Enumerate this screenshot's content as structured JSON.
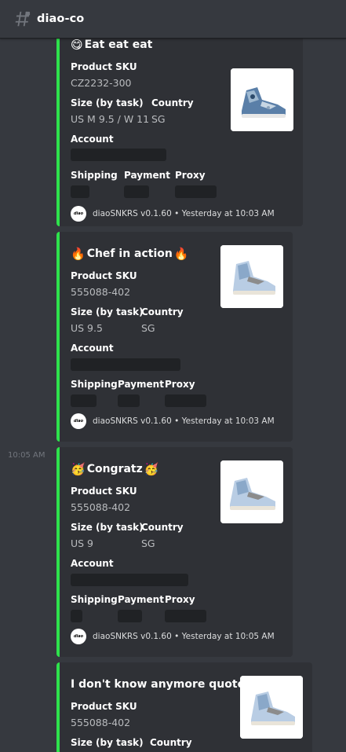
{
  "channel": {
    "name": "diao-co",
    "icon": "hashtag-lock-icon"
  },
  "colors": {
    "background": "#36393f",
    "embed_bg": "#2f3136",
    "embed_border": "#2ee24c",
    "redaction": "#202225"
  },
  "timestamps": {
    "second_group": "10:05 AM"
  },
  "field_labels": {
    "sku": "Product SKU",
    "size": "Size (by task)",
    "country": "Country",
    "account": "Account",
    "shipping": "Shipping",
    "payment": "Payment",
    "proxy": "Proxy"
  },
  "messages": [
    {
      "title": "Eat eat eat",
      "sku": "CZ2232-300",
      "size": "US M 9.5 / W 11",
      "country": "SG",
      "footer_icon_text": "diao",
      "footer": "diaoSNKRS v0.1.60 • Yesterday at 10:03 AM"
    },
    {
      "title": "Chef in action",
      "title_emoji": "🔥",
      "sku": "555088-402",
      "size": "US 9.5",
      "country": "SG",
      "footer_icon_text": "diao",
      "footer": "diaoSNKRS v0.1.60 • Yesterday at 10:03 AM"
    },
    {
      "title": "Congratz",
      "title_emoji": "🥳",
      "sku": "555088-402",
      "size": "US 9",
      "country": "SG",
      "footer_icon_text": "diao",
      "footer": "diaoSNKRS v0.1.60 • Yesterday at 10:05 AM"
    },
    {
      "title": "I don't know anymore quotes",
      "sku": "555088-402",
      "size": "",
      "country": ""
    }
  ]
}
